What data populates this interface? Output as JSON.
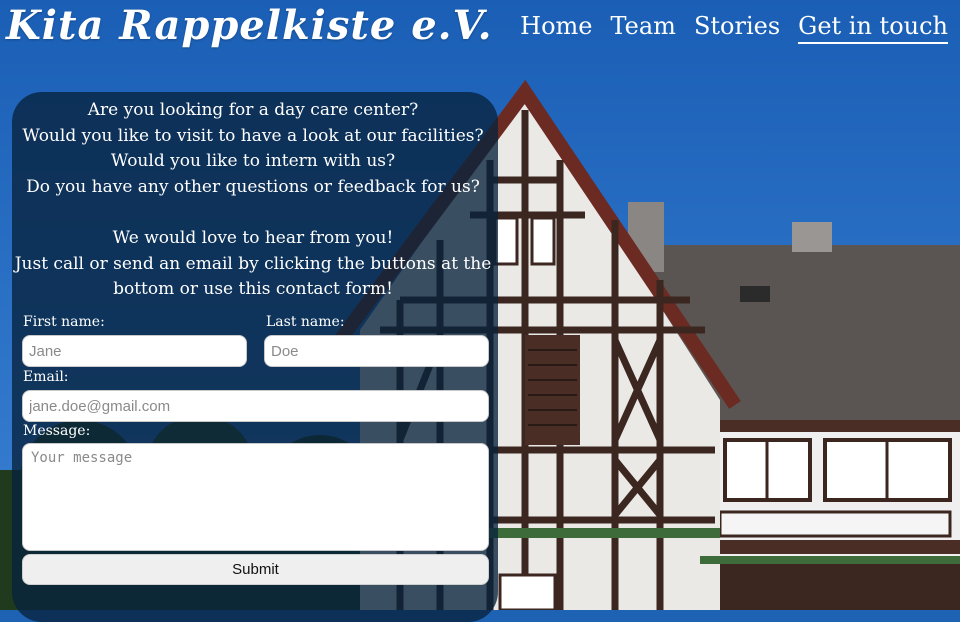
{
  "header": {
    "brand": "Kita Rappelkiste e.V.",
    "nav": [
      {
        "label": "Home",
        "active": false
      },
      {
        "label": "Team",
        "active": false
      },
      {
        "label": "Stories",
        "active": false
      },
      {
        "label": "Get in touch",
        "active": true
      }
    ]
  },
  "contact": {
    "intro_lines": [
      "Are you looking for a day care center?",
      "Would you like to visit to have a look at our facilities?",
      "Would you like to intern with us?",
      "Do you have any other questions or feedback for us?"
    ],
    "cta_lines": [
      "We would love to hear from you!",
      "Just call or send an email by clicking the buttons at the",
      "bottom or use this contact form!"
    ],
    "form": {
      "first_name_label": "First name:",
      "first_name_placeholder": "Jane",
      "last_name_label": "Last name:",
      "last_name_placeholder": "Doe",
      "email_label": "Email:",
      "email_placeholder": "jane.doe@gmail.com",
      "message_label": "Message:",
      "message_placeholder": "Your message",
      "submit_label": "Submit"
    }
  },
  "colors": {
    "sky": "#1e62b4",
    "panel": "#08233c",
    "text": "#ffffff",
    "timber": "#3b2620",
    "roof": "#5a5553"
  }
}
